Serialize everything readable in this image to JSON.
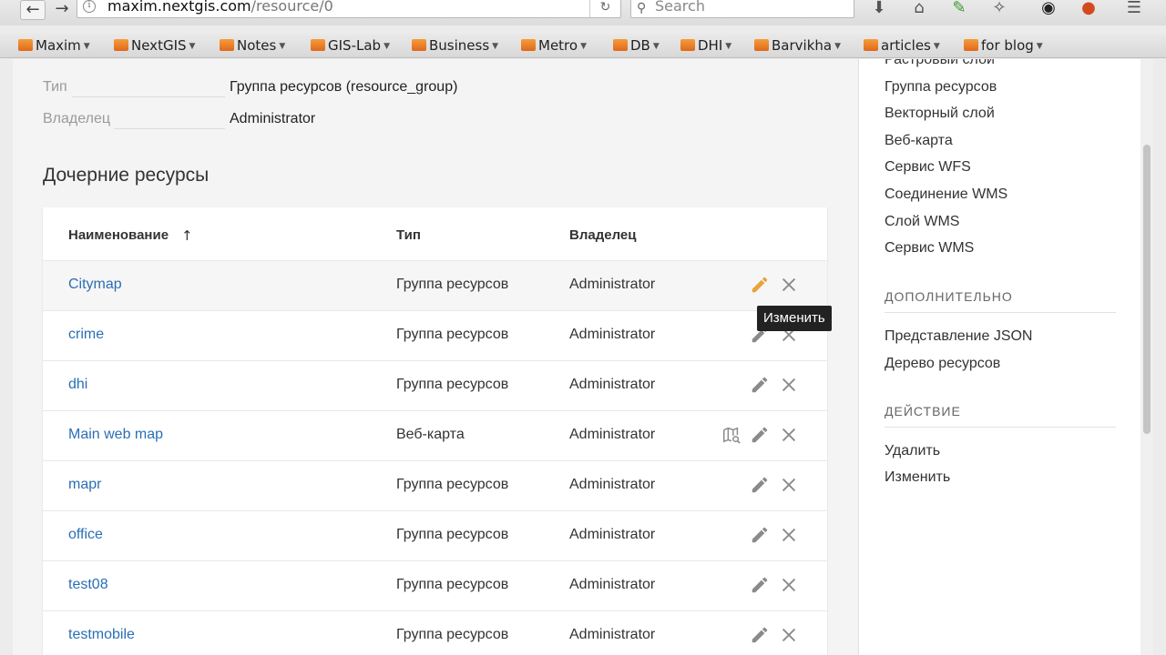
{
  "browser": {
    "url_domain": "maxim.nextgis.com",
    "url_path": "/resource/0",
    "search_placeholder": "Search",
    "bookmarks": [
      "Maxim",
      "NextGIS",
      "Notes",
      "GIS-Lab",
      "Business",
      "Metro",
      "DB",
      "DHI",
      "Barvikha",
      "articles",
      "for blog"
    ]
  },
  "meta": {
    "type_label": "Тип",
    "type_value": "Группа ресурсов (resource_group)",
    "owner_label": "Владелец",
    "owner_value": "Administrator"
  },
  "children": {
    "title": "Дочерние ресурсы",
    "headers": {
      "name": "Наименование",
      "type": "Тип",
      "owner": "Владелец"
    },
    "rows": [
      {
        "name": "Citymap",
        "type": "Группа ресурсов",
        "owner": "Administrator"
      },
      {
        "name": "crime",
        "type": "Группа ресурсов",
        "owner": "Administrator"
      },
      {
        "name": "dhi",
        "type": "Группа ресурсов",
        "owner": "Administrator"
      },
      {
        "name": "Main web map",
        "type": "Веб-карта",
        "owner": "Administrator"
      },
      {
        "name": "mapr",
        "type": "Группа ресурсов",
        "owner": "Administrator"
      },
      {
        "name": "office",
        "type": "Группа ресурсов",
        "owner": "Administrator"
      },
      {
        "name": "test08",
        "type": "Группа ресурсов",
        "owner": "Administrator"
      },
      {
        "name": "testmobile",
        "type": "Группа ресурсов",
        "owner": "Administrator"
      }
    ],
    "tooltip": "Изменить"
  },
  "sidebar": {
    "create_items": [
      "Растровый слой",
      "Группа ресурсов",
      "Векторный слой",
      "Веб-карта",
      "Сервис WFS",
      "Соединение WMS",
      "Слой WMS",
      "Сервис WMS"
    ],
    "extra_heading": "ДОПОЛНИТЕЛЬНО",
    "extra_items": [
      "Представление JSON",
      "Дерево ресурсов"
    ],
    "action_heading": "ДЕЙСТВИЕ",
    "action_items": [
      "Удалить",
      "Изменить"
    ]
  },
  "colors": {
    "link": "#2a6fb5",
    "folder": "#e97b23"
  }
}
